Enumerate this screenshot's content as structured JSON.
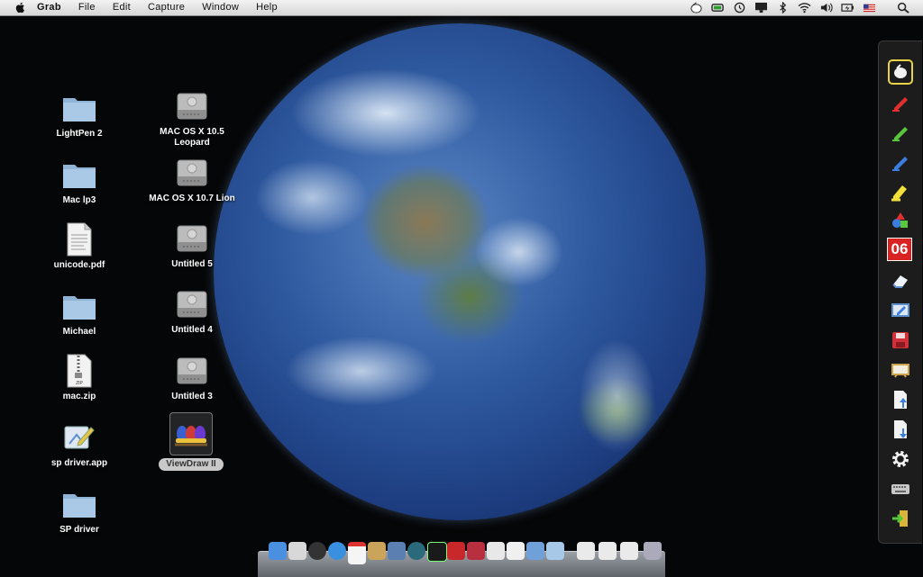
{
  "menubar": {
    "app": "Grab",
    "items": [
      "File",
      "Edit",
      "Capture",
      "Window",
      "Help"
    ]
  },
  "status_icons": [
    "whiteboard-pen-icon",
    "battery-app-icon",
    "time-machine-icon",
    "display-icon",
    "bluetooth-icon",
    "wifi-icon",
    "volume-icon",
    "battery-icon",
    "us-flag-icon",
    "spotlight-search-icon"
  ],
  "desktop": {
    "left_column": [
      {
        "label": "LightPen 2",
        "icon": "folder-icon"
      },
      {
        "label": "Mac lp3",
        "icon": "folder-icon"
      },
      {
        "label": "unicode.pdf",
        "icon": "pdf-document-icon"
      },
      {
        "label": "Michael",
        "icon": "folder-icon"
      },
      {
        "label": "mac.zip",
        "icon": "zip-file-icon"
      },
      {
        "label": "sp driver.app",
        "icon": "app-icon"
      },
      {
        "label": "SP driver",
        "icon": "folder-icon"
      }
    ],
    "right_column": [
      {
        "label": "MAC OS X 10.5\nLeopard",
        "icon": "hard-drive-icon"
      },
      {
        "label": "MAC OS X 10.7 Lion",
        "icon": "hard-drive-icon"
      },
      {
        "label": "Untitled 5",
        "icon": "hard-drive-icon"
      },
      {
        "label": "Untitled 4",
        "icon": "hard-drive-icon"
      },
      {
        "label": "Untitled 3",
        "icon": "hard-drive-icon"
      },
      {
        "label": "ViewDraw II",
        "icon": "viewdraw-app-icon"
      }
    ]
  },
  "toolbar": {
    "tools": [
      "mouse-cursor-icon",
      "red-pen-icon",
      "green-pen-icon",
      "blue-pen-icon",
      "yellow-highlighter-icon",
      "shapes-icon",
      "page-number",
      "eraser-icon",
      "screen-capture-icon",
      "save-icon",
      "blank-board-icon",
      "page-up-icon",
      "page-down-icon",
      "settings-gear-icon",
      "keyboard-icon",
      "exit-icon"
    ],
    "page_number": "06",
    "active_tool": "mouse-cursor-icon",
    "active_color": "#e8d24a"
  },
  "dock": {
    "items": [
      "finder",
      "preview",
      "dashboard",
      "safari",
      "ical",
      "address-book",
      "expose",
      "time-machine",
      "activity-monitor",
      "app-red",
      "app-red-2",
      "documents",
      "text-edit",
      "iphoto",
      "mail",
      "stacks-1",
      "stacks-2",
      "stacks-3",
      "trash"
    ]
  }
}
